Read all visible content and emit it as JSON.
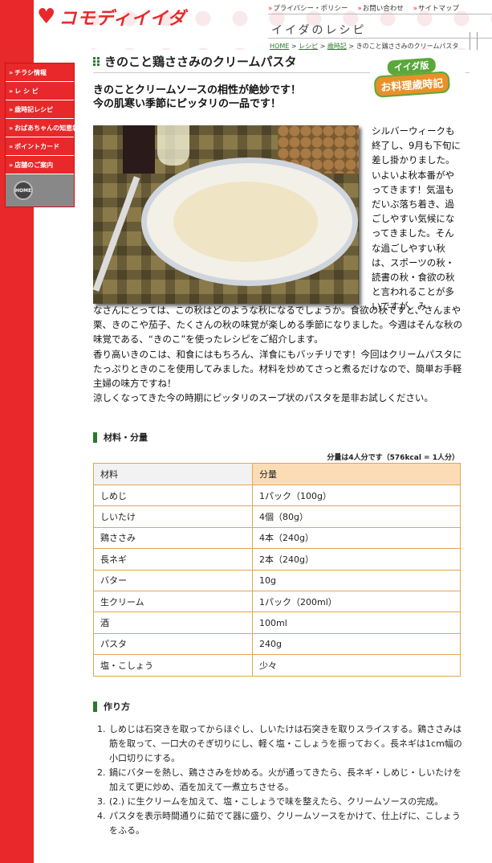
{
  "site": {
    "logo_mark": "♥",
    "logo_text": "コモディイイダ",
    "top_links": [
      "プライバシー・ポリシー",
      "お問い合わせ",
      "サイトマップ"
    ],
    "section_title": "イイダのレシピ",
    "breadcrumb": {
      "home": "HOME",
      "recipes": "レシピ",
      "seasonal": "歳時記",
      "current": "きのこと鶏ささみのクリームパスタ",
      "sep": " > "
    }
  },
  "nav": {
    "items": [
      "チラシ情報",
      "レ シ ピ",
      "歳時記レシピ",
      "おばあちゃんの知恵袋",
      "ポイントカード",
      "店舗のご案内"
    ],
    "home_label": "HOME"
  },
  "badge": {
    "line1": "イイダ版",
    "line2": "お料理歳時記"
  },
  "page_title": "きのこと鶏ささみのクリームパスタ",
  "lead": [
    "きのことクリームソースの相性が絶妙です！",
    "今の肌寒い季節にピッタリの一品です！"
  ],
  "side_text": "シルバーウィークも終了し、9月も下旬に差し掛かりました。いよいよ秋本番がやってきます！気温もだいぶ落ち着き、過ごしやすい気候になってきました。そんな過ごしやすい秋は、スポーツの秋・読書の秋・食欲の秋と言われることが多いですが、み",
  "body_text": [
    "なさんにとっては、この秋はどのような秋になるでしょうか。食欲の秋ですと、さんまや栗、きのこや茄子、たくさんの秋の味覚が楽しめる季節になりました。今週はそんな秋の味覚である、“きのこ”を使ったレシピをご紹介します。",
    "香り高いきのこは、和食にはもちろん、洋食にもバッチリです！今回はクリームパスタにたっぷりときのこを使用してみました。材料を炒めてさっと煮るだけなので、簡単お手軽主婦の味方ですね！",
    "涼しくなってきた今の時期にピッタリのスープ状のパスタを是非お試しください。"
  ],
  "ingredients": {
    "heading": "材料・分量",
    "servings": "分量は4人分です（576kcal = 1人分）",
    "col_name": "材料",
    "col_amount": "分量",
    "rows": [
      {
        "name": "しめじ",
        "amount": "1パック（100g）"
      },
      {
        "name": "しいたけ",
        "amount": "4個（80g）"
      },
      {
        "name": "鶏ささみ",
        "amount": "4本（240g）"
      },
      {
        "name": "長ネギ",
        "amount": "2本（240g）"
      },
      {
        "name": "バター",
        "amount": "10g"
      },
      {
        "name": "生クリーム",
        "amount": "1パック（200ml）"
      },
      {
        "name": "酒",
        "amount": "100ml"
      },
      {
        "name": "パスタ",
        "amount": "240g"
      },
      {
        "name": "塩・こしょう",
        "amount": "少々"
      }
    ]
  },
  "method": {
    "heading": "作り方",
    "steps": [
      "しめじは石突きを取ってからほぐし、しいたけは石突きを取りスライスする。鶏ささみは筋を取って、一口大のそぎ切りにし、軽く塩・こしょうを振っておく。長ネギは1cm幅の小口切りにする。",
      "鍋にバターを熱し、鶏ささみを炒める。火が通ってきたら、長ネギ・しめじ・しいたけを加えて更に炒め、酒を加えて一煮立ちさせる。",
      "(2.) に生クリームを加えて、塩・こしょうで味を整えたら、クリームソースの完成。",
      "パスタを表示時間通りに茹でて器に盛り、クリームソースをかけて、仕上げに、こしょうをふる。"
    ]
  }
}
